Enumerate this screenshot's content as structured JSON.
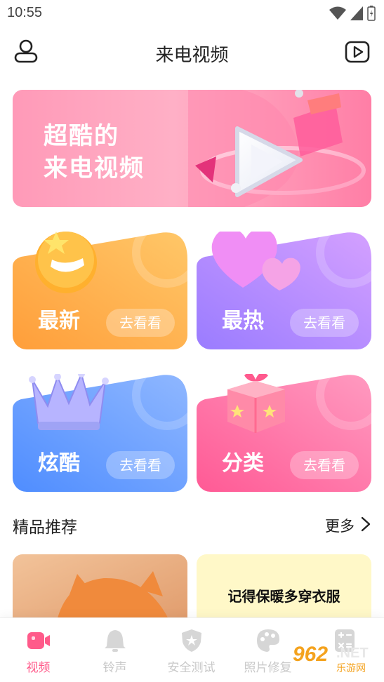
{
  "status": {
    "time": "10:55"
  },
  "header": {
    "title": "来电视频",
    "user_icon": "user-icon",
    "video_icon": "video-icon"
  },
  "banner": {
    "line1": "超酷的",
    "line2": "来电视频"
  },
  "categories": [
    {
      "label": "最新",
      "button": "去看看",
      "color_from": "#ff9e3a",
      "color_to": "#ffc768",
      "icon": "smile-emoji-icon"
    },
    {
      "label": "最热",
      "button": "去看看",
      "color_from": "#9a7cff",
      "color_to": "#d4a0ff",
      "icon": "heart-icon"
    },
    {
      "label": "炫酷",
      "button": "去看看",
      "color_from": "#4f8dff",
      "color_to": "#8fb7ff",
      "icon": "crown-icon"
    },
    {
      "label": "分类",
      "button": "去看看",
      "color_from": "#ff5a95",
      "color_to": "#ff9ac0",
      "icon": "gift-box-icon"
    }
  ],
  "section": {
    "title": "精品推荐",
    "more": "更多"
  },
  "recommend": [
    {
      "text": ""
    },
    {
      "text": "记得保暖多穿衣服"
    }
  ],
  "tabs": [
    {
      "label": "视频",
      "icon": "video-camera-icon",
      "active": true
    },
    {
      "label": "铃声",
      "icon": "bell-icon",
      "active": false
    },
    {
      "label": "安全测试",
      "icon": "shield-star-icon",
      "active": false
    },
    {
      "label": "照片修复",
      "icon": "palette-icon",
      "active": false
    },
    {
      "label": "",
      "icon": "calculator-icon",
      "active": false
    }
  ],
  "watermark": {
    "number": "962",
    "net": ".NET",
    "sub": "乐游网"
  },
  "colors": {
    "accent": "#ff5a8a",
    "tab_inactive": "#c8c8c8"
  }
}
